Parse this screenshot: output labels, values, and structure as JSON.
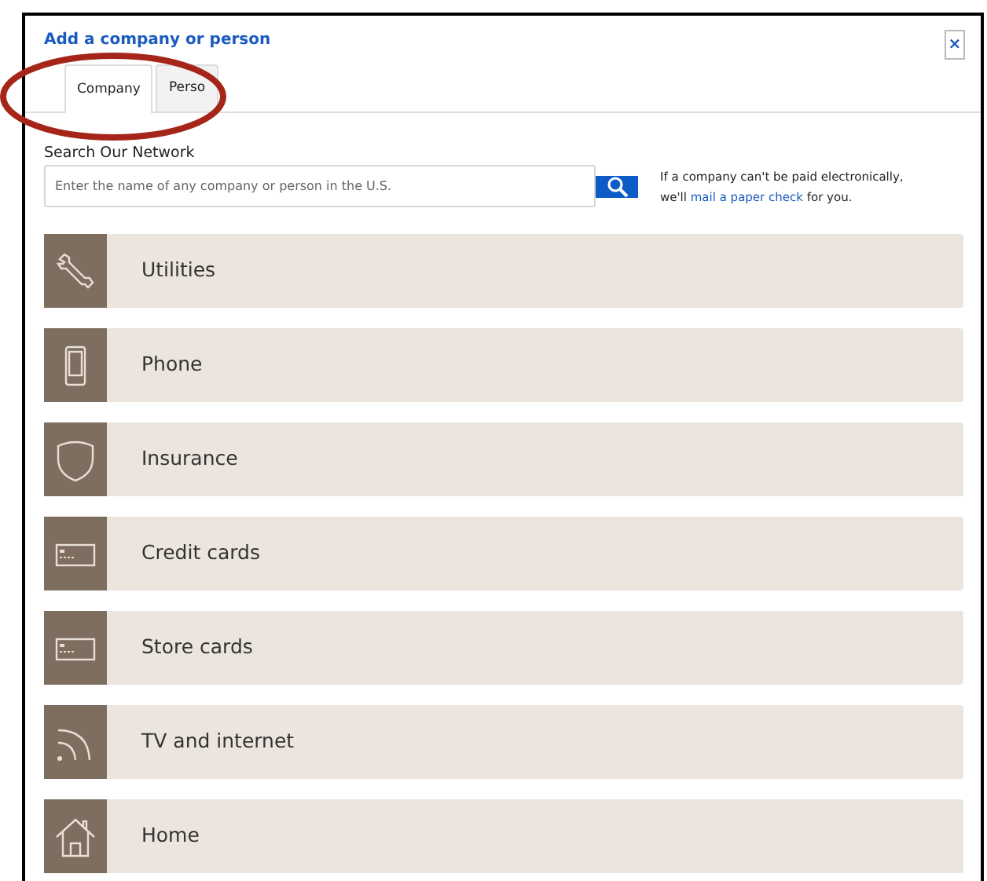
{
  "dialog": {
    "title": "Add a company or person",
    "close": "×"
  },
  "tabs": [
    {
      "label": "Company",
      "selected": true
    },
    {
      "label": "Perso",
      "selected": false
    }
  ],
  "search": {
    "label": "Search Our Network",
    "placeholder": "Enter the name of any company or person in the U.S."
  },
  "note": {
    "before": "If a company can't be paid electronically,",
    "line2_start": "we'll",
    "link": "mail a paper check",
    "after": "for you."
  },
  "categories": [
    {
      "label": "Utilities",
      "kind": "wrench"
    },
    {
      "label": "Phone",
      "kind": "phone"
    },
    {
      "label": "Insurance",
      "kind": "shield"
    },
    {
      "label": "Credit cards",
      "kind": "card"
    },
    {
      "label": "Store cards",
      "kind": "card"
    },
    {
      "label": "TV and internet",
      "kind": "signal"
    },
    {
      "label": "Home",
      "kind": "house"
    }
  ]
}
